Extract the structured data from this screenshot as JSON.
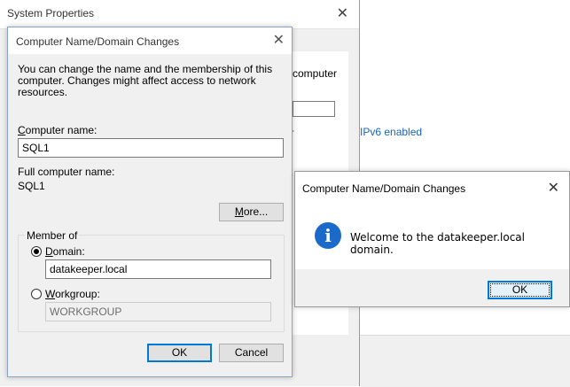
{
  "system_properties": {
    "title": "System Properties",
    "partial_text_computer": "computer",
    "partial_text_ipv6": "IPv6 enabled",
    "partial_dash": "-"
  },
  "computer_name_dialog": {
    "title": "Computer Name/Domain Changes",
    "intro": "You can change the name and the membership of this computer. Changes might affect access to network resources.",
    "computer_name_label_accel": "C",
    "computer_name_label_rest": "omputer name:",
    "computer_name_value": "SQL1",
    "full_computer_name_label": "Full computer name:",
    "full_computer_name_value": "SQL1",
    "more_button_accel": "M",
    "more_button_rest": "ore...",
    "member_of_label": "Member of",
    "domain_label_accel": "D",
    "domain_label_rest": "omain:",
    "domain_value": "datakeeper.local",
    "domain_selected": true,
    "workgroup_label_accel": "W",
    "workgroup_label_rest": "orkgroup:",
    "workgroup_value": "WORKGROUP",
    "ok_label": "OK",
    "cancel_label": "Cancel"
  },
  "message_box": {
    "title": "Computer Name/Domain Changes",
    "message": "Welcome to the datakeeper.local domain.",
    "icon": "info-icon",
    "ok_label": "OK"
  },
  "colors": {
    "accent": "#0078d7",
    "info_icon": "#1b6ac9",
    "link": "#1a64b4"
  }
}
